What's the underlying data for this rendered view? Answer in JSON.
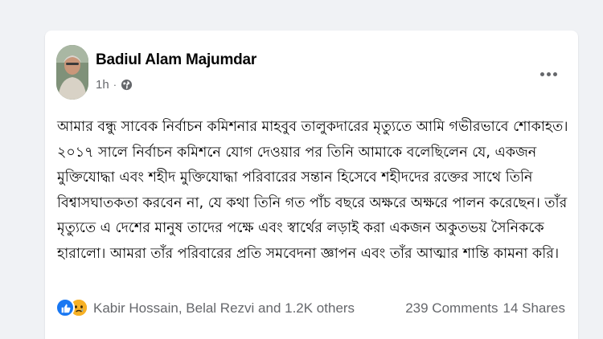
{
  "post": {
    "author": "Badiul Alam Majumdar",
    "time": "1h",
    "separator": "·",
    "privacy_icon": "globe-icon",
    "more_icon": "more-options-icon",
    "text": "আমার বন্ধু সাবেক নির্বাচন কমিশনার মাহবুব তালুকদারের মৃত্যুতে আমি গভীরভাবে শোকাহত। ২০১৭ সালে নির্বাচন কমিশনে যোগ দেওয়ার পর তিনি আমাকে বলেছিলেন যে, একজন মুক্তিযোদ্ধা এবং শহীদ মুক্তিযোদ্ধা পরিবারের সন্তান হিসেবে শহীদদের রক্তের সাথে তিনি বিশ্বাসঘাতকতা করবেন না, যে কথা তিনি গত পাঁচ বছরে অক্ষরে অক্ষরে পালন করেছেন। তাঁর মৃত্যুতে এ দেশের মানুষ তাদের পক্ষে এবং স্বার্থের লড়াই করা একজন অকুতভয় সৈনিককে হারালো। আমরা তাঁর পরিবারের প্রতি সমবেদনা জ্ঞাপন এবং তাঁর আত্মার শান্তি কামনা করি।"
  },
  "footer": {
    "reaction_icons": [
      "like-icon",
      "sad-icon"
    ],
    "reacted_by": "Kabir Hossain, Belal Rezvi and 1.2K others",
    "comments": "239 Comments",
    "shares": "14 Shares"
  },
  "colors": {
    "background": "#f0f2f5",
    "card": "#ffffff",
    "text": "#050505",
    "secondary_text": "#65676b",
    "like_blue": "#1877f2",
    "sad_yellow": "#f7b125"
  }
}
